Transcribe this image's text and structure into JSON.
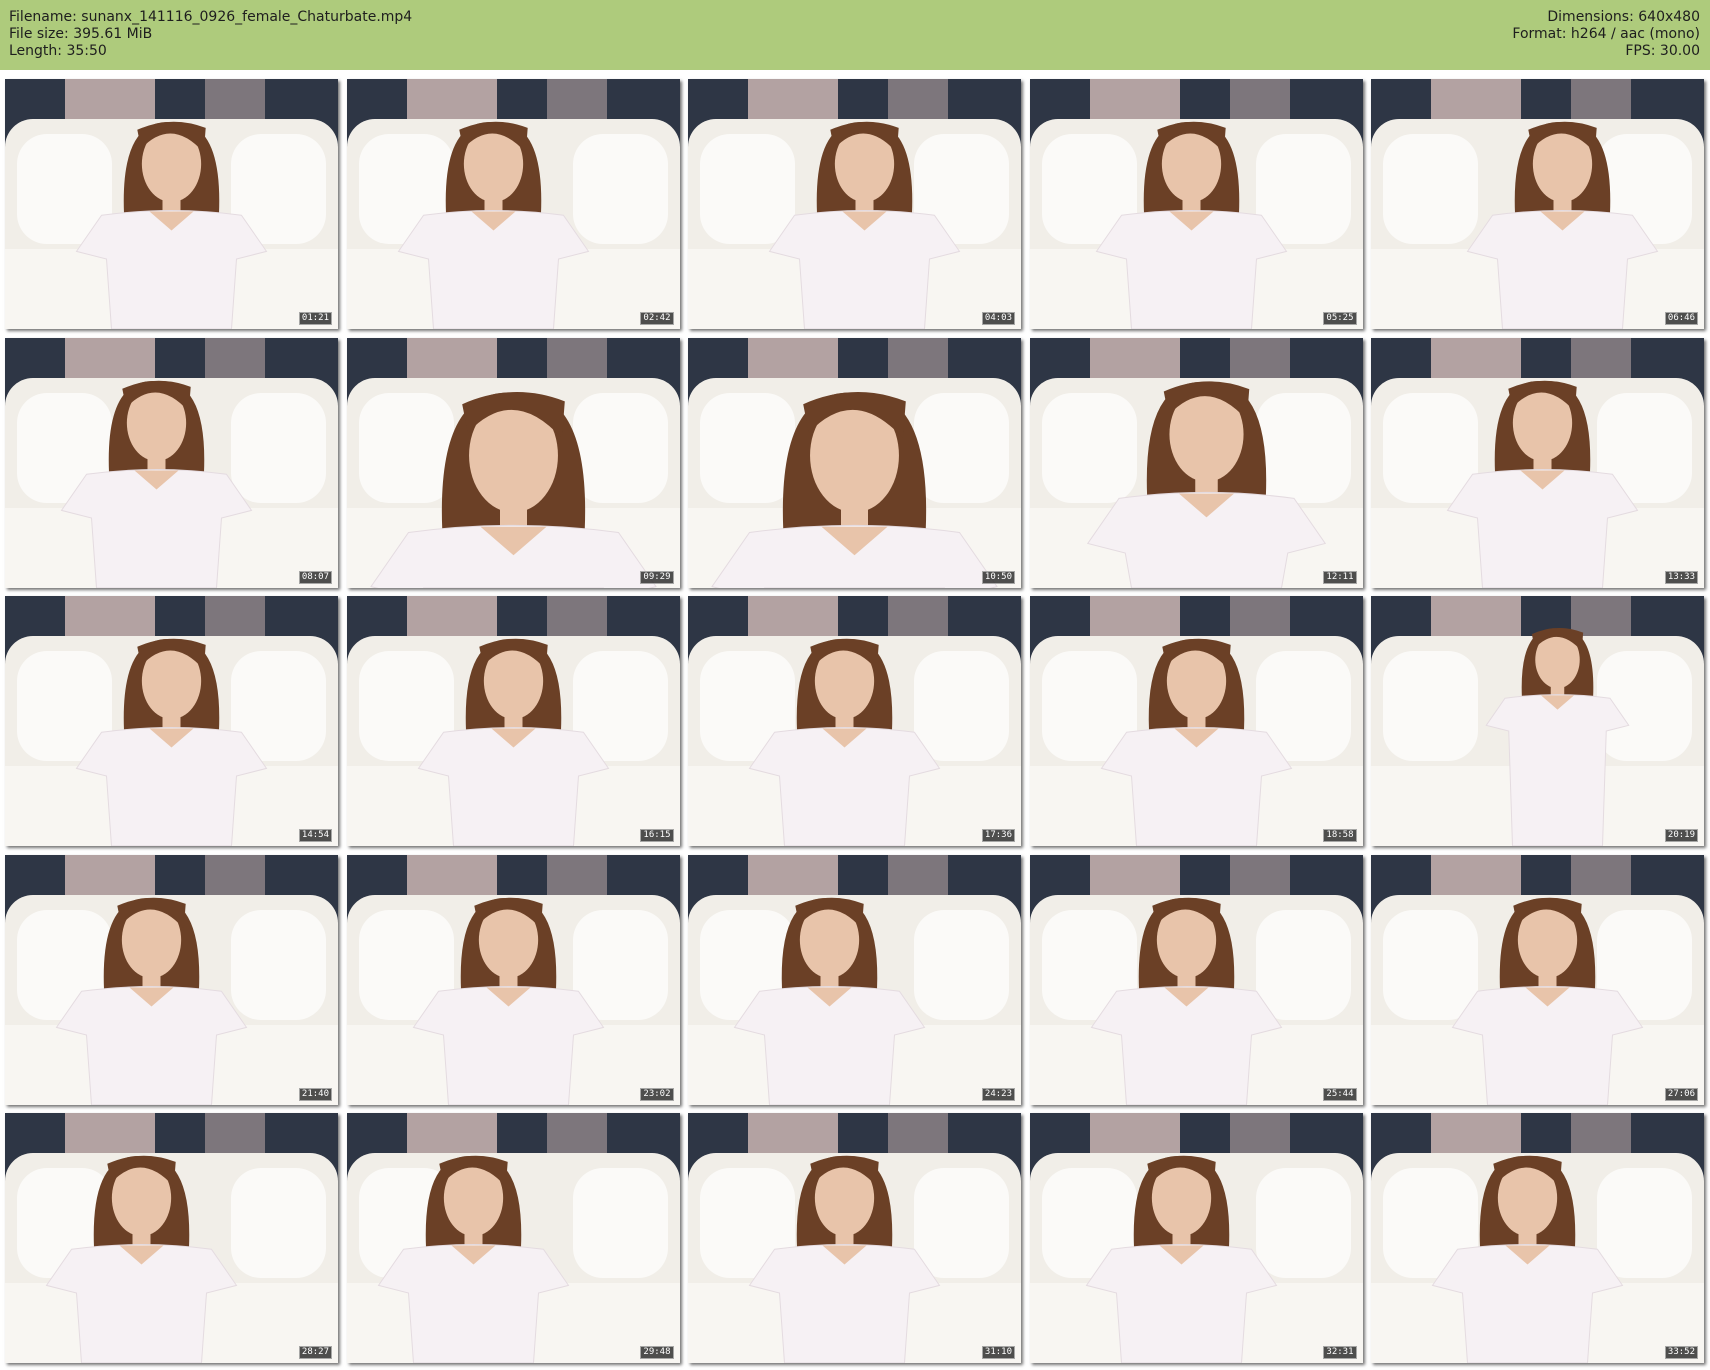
{
  "header": {
    "filename_line": "Filename: sunanx_141116_0926_female_Chaturbate.mp4",
    "filesize_line": "File size: 395.61 MiB",
    "length_line": "Length: 35:50",
    "dimensions_line": "Dimensions: 640x480",
    "format_line": "Format: h264 / aac (mono)",
    "fps_line": "FPS: 30.00"
  },
  "colors": {
    "header_bg": "#aecb7c",
    "wall": "#2e3645",
    "curtain": "#b3a2a2",
    "sofa": "#f1eee8",
    "shirt": "#f6f1f4",
    "hair": "#6b4026",
    "skin": "#e8c4aa"
  },
  "thumbnails": [
    {
      "time": "01:21"
    },
    {
      "time": "02:42"
    },
    {
      "time": "04:03"
    },
    {
      "time": "05:25"
    },
    {
      "time": "06:46"
    },
    {
      "time": "08:07"
    },
    {
      "time": "09:29"
    },
    {
      "time": "10:50"
    },
    {
      "time": "12:11"
    },
    {
      "time": "13:33"
    },
    {
      "time": "14:54"
    },
    {
      "time": "16:15"
    },
    {
      "time": "17:36"
    },
    {
      "time": "18:58"
    },
    {
      "time": "20:19"
    },
    {
      "time": "21:40"
    },
    {
      "time": "23:02"
    },
    {
      "time": "24:23"
    },
    {
      "time": "25:44"
    },
    {
      "time": "27:06"
    },
    {
      "time": "28:27"
    },
    {
      "time": "29:48"
    },
    {
      "time": "31:10"
    },
    {
      "time": "32:31"
    },
    {
      "time": "33:52"
    }
  ]
}
